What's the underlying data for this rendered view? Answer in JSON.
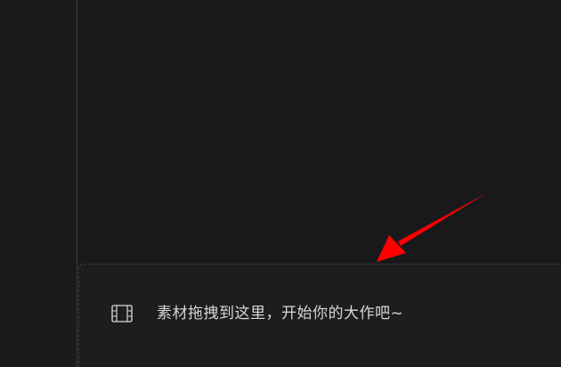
{
  "timeline": {
    "drop_zone": {
      "icon": "film-icon",
      "hint_text": "素材拖拽到这里，开始你的大作吧~"
    }
  },
  "annotation": {
    "arrow_color": "#ff0000"
  }
}
